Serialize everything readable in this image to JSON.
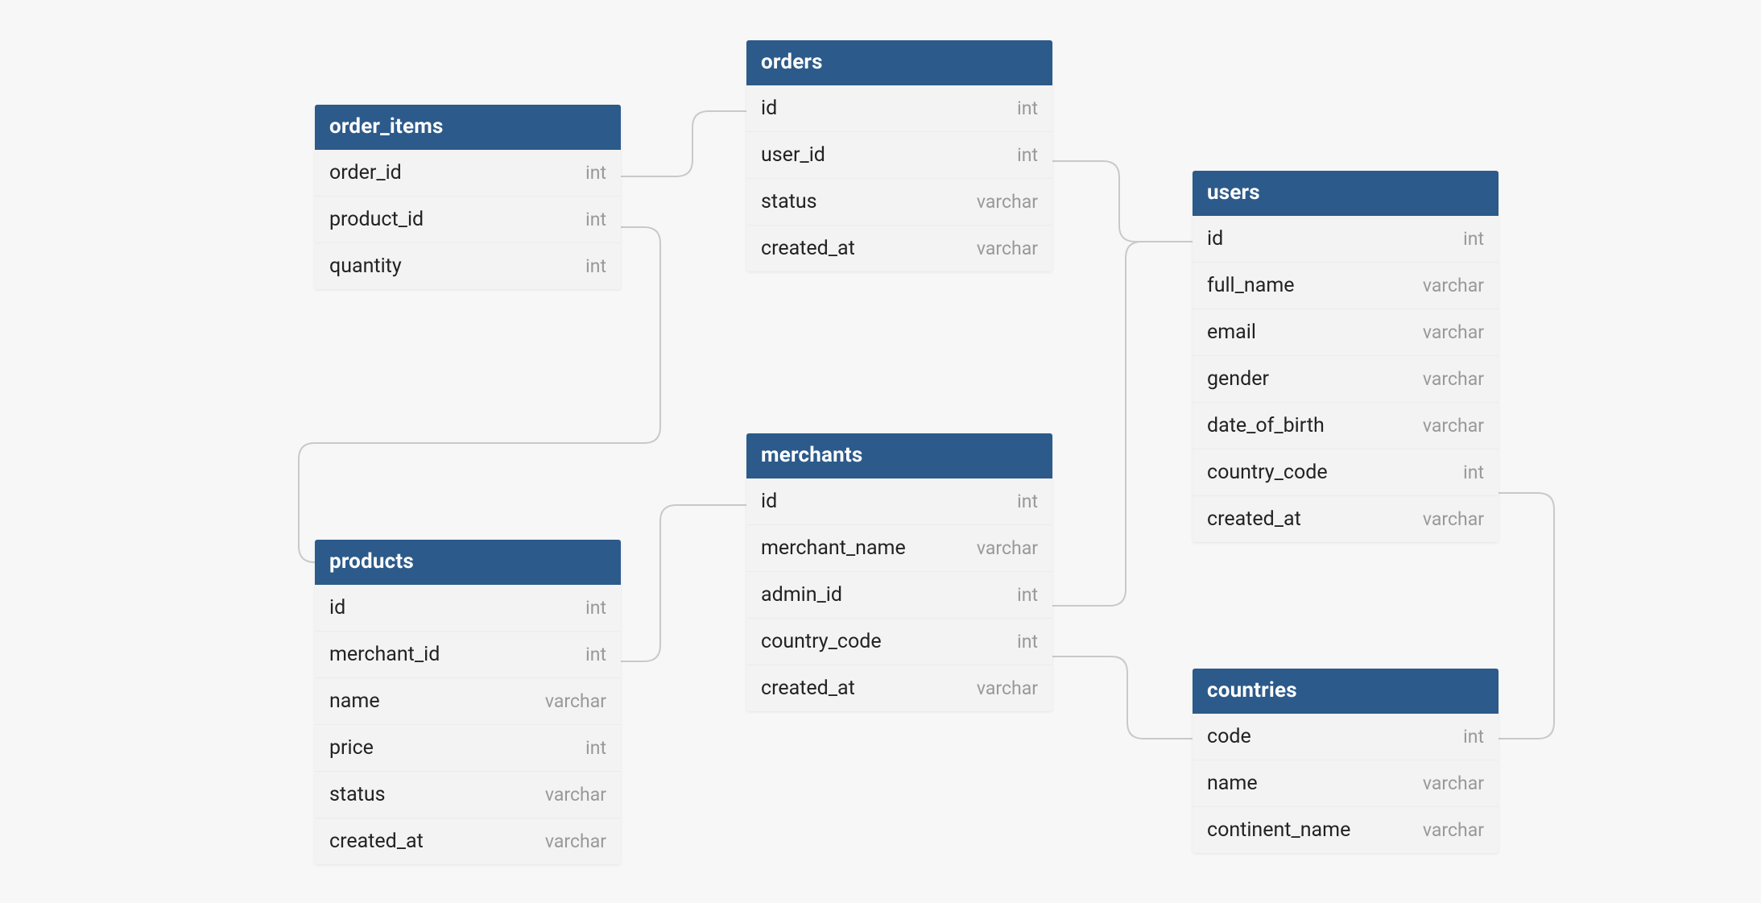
{
  "colors": {
    "header_bg": "#2c5a8a",
    "header_fg": "#ffffff",
    "canvas_bg": "#f7f7f7",
    "type_fg": "#999999"
  },
  "tables": {
    "order_items": {
      "title": "order_items",
      "columns": [
        {
          "name": "order_id",
          "type": "int"
        },
        {
          "name": "product_id",
          "type": "int"
        },
        {
          "name": "quantity",
          "type": "int"
        }
      ]
    },
    "orders": {
      "title": "orders",
      "columns": [
        {
          "name": "id",
          "type": "int"
        },
        {
          "name": "user_id",
          "type": "int"
        },
        {
          "name": "status",
          "type": "varchar"
        },
        {
          "name": "created_at",
          "type": "varchar"
        }
      ]
    },
    "products": {
      "title": "products",
      "columns": [
        {
          "name": "id",
          "type": "int"
        },
        {
          "name": "merchant_id",
          "type": "int"
        },
        {
          "name": "name",
          "type": "varchar"
        },
        {
          "name": "price",
          "type": "int"
        },
        {
          "name": "status",
          "type": "varchar"
        },
        {
          "name": "created_at",
          "type": "varchar"
        }
      ]
    },
    "merchants": {
      "title": "merchants",
      "columns": [
        {
          "name": "id",
          "type": "int"
        },
        {
          "name": "merchant_name",
          "type": "varchar"
        },
        {
          "name": "admin_id",
          "type": "int"
        },
        {
          "name": "country_code",
          "type": "int"
        },
        {
          "name": "created_at",
          "type": "varchar"
        }
      ]
    },
    "users": {
      "title": "users",
      "columns": [
        {
          "name": "id",
          "type": "int"
        },
        {
          "name": "full_name",
          "type": "varchar"
        },
        {
          "name": "email",
          "type": "varchar"
        },
        {
          "name": "gender",
          "type": "varchar"
        },
        {
          "name": "date_of_birth",
          "type": "varchar"
        },
        {
          "name": "country_code",
          "type": "int"
        },
        {
          "name": "created_at",
          "type": "varchar"
        }
      ]
    },
    "countries": {
      "title": "countries",
      "columns": [
        {
          "name": "code",
          "type": "int"
        },
        {
          "name": "name",
          "type": "varchar"
        },
        {
          "name": "continent_name",
          "type": "varchar"
        }
      ]
    }
  },
  "relationships": [
    {
      "from": "order_items.order_id",
      "to": "orders.id"
    },
    {
      "from": "order_items.product_id",
      "to": "products.id"
    },
    {
      "from": "products.merchant_id",
      "to": "merchants.id"
    },
    {
      "from": "orders.user_id",
      "to": "users.id"
    },
    {
      "from": "merchants.admin_id",
      "to": "users.id"
    },
    {
      "from": "merchants.country_code",
      "to": "countries.code"
    },
    {
      "from": "users.country_code",
      "to": "countries.code"
    }
  ]
}
